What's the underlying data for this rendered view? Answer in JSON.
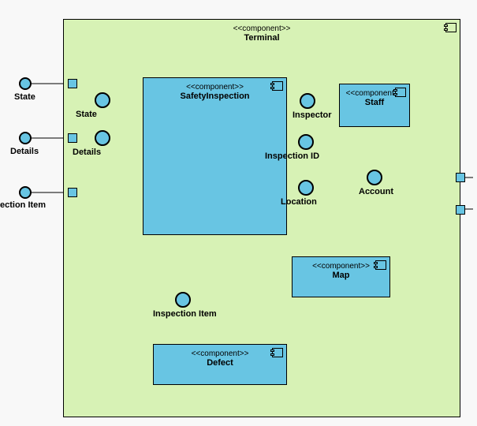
{
  "stereotype": "<<component>>",
  "terminal": {
    "title": "Terminal"
  },
  "safetyInspection": {
    "title": "SafetyInspection"
  },
  "staff": {
    "title": "Staff"
  },
  "map": {
    "title": "Map"
  },
  "defect": {
    "title": "Defect"
  },
  "interfaces": {
    "state": "State",
    "details": "Details",
    "inspectionItem": "Inspection Item",
    "inspector": "Inspector",
    "inspectionId": "Inspection ID",
    "location": "Location",
    "account": "Account"
  },
  "external": {
    "state": "State",
    "details": "Details",
    "ectionItem": "ection Item"
  }
}
